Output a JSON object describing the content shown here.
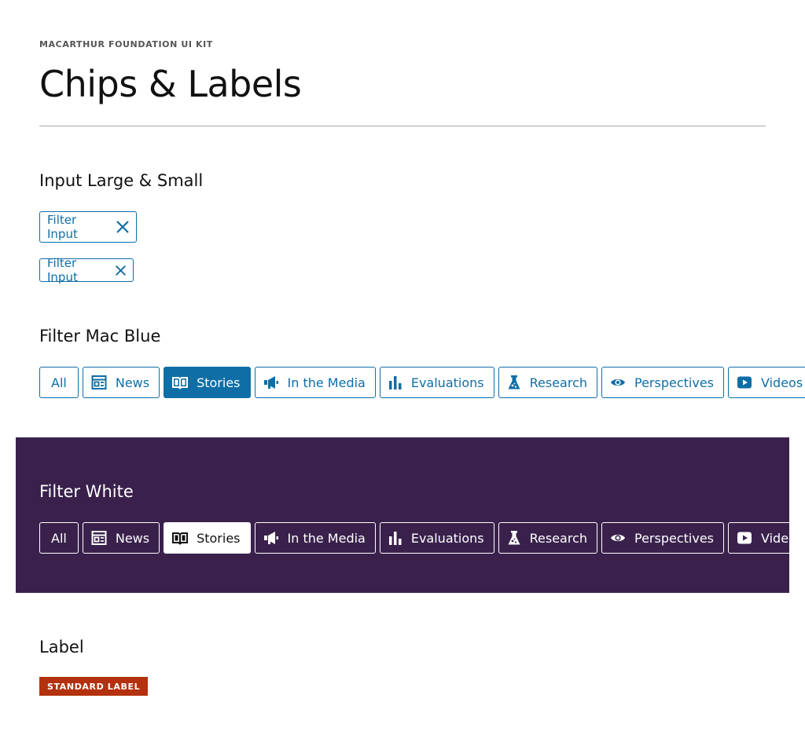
{
  "header": {
    "kit_label": "MACARTHUR FOUNDATION UI KIT",
    "title": "Chips & Labels"
  },
  "colors": {
    "mac_blue": "#0f6ea6",
    "purple_band": "#3a214c",
    "label_red": "#b3310e"
  },
  "input_section": {
    "title": "Input Large & Small",
    "large_chip": {
      "label": "Filter Input",
      "icon": "close-icon"
    },
    "small_chip": {
      "label": "Filter Input",
      "icon": "close-icon"
    }
  },
  "filter_blue": {
    "title": "Filter Mac Blue",
    "items": [
      {
        "label": "All",
        "icon": null,
        "active": false
      },
      {
        "label": "News",
        "icon": "newspaper-icon",
        "active": false
      },
      {
        "label": "Stories",
        "icon": "book-icon",
        "active": true
      },
      {
        "label": "In the Media",
        "icon": "megaphone-icon",
        "active": false
      },
      {
        "label": "Evaluations",
        "icon": "bar-chart-icon",
        "active": false
      },
      {
        "label": "Research",
        "icon": "flask-icon",
        "active": false
      },
      {
        "label": "Perspectives",
        "icon": "eye-icon",
        "active": false
      },
      {
        "label": "Videos",
        "icon": "play-icon",
        "active": false
      }
    ]
  },
  "filter_white": {
    "title": "Filter White",
    "items": [
      {
        "label": "All",
        "icon": null,
        "active": false
      },
      {
        "label": "News",
        "icon": "newspaper-icon",
        "active": false
      },
      {
        "label": "Stories",
        "icon": "book-icon",
        "active": true
      },
      {
        "label": "In the Media",
        "icon": "megaphone-icon",
        "active": false
      },
      {
        "label": "Evaluations",
        "icon": "bar-chart-icon",
        "active": false
      },
      {
        "label": "Research",
        "icon": "flask-icon",
        "active": false
      },
      {
        "label": "Perspectives",
        "icon": "eye-icon",
        "active": false
      },
      {
        "label": "Videos",
        "icon": "play-icon",
        "active": false
      }
    ]
  },
  "label_section": {
    "title": "Label",
    "standard_label": "STANDARD LABEL"
  }
}
